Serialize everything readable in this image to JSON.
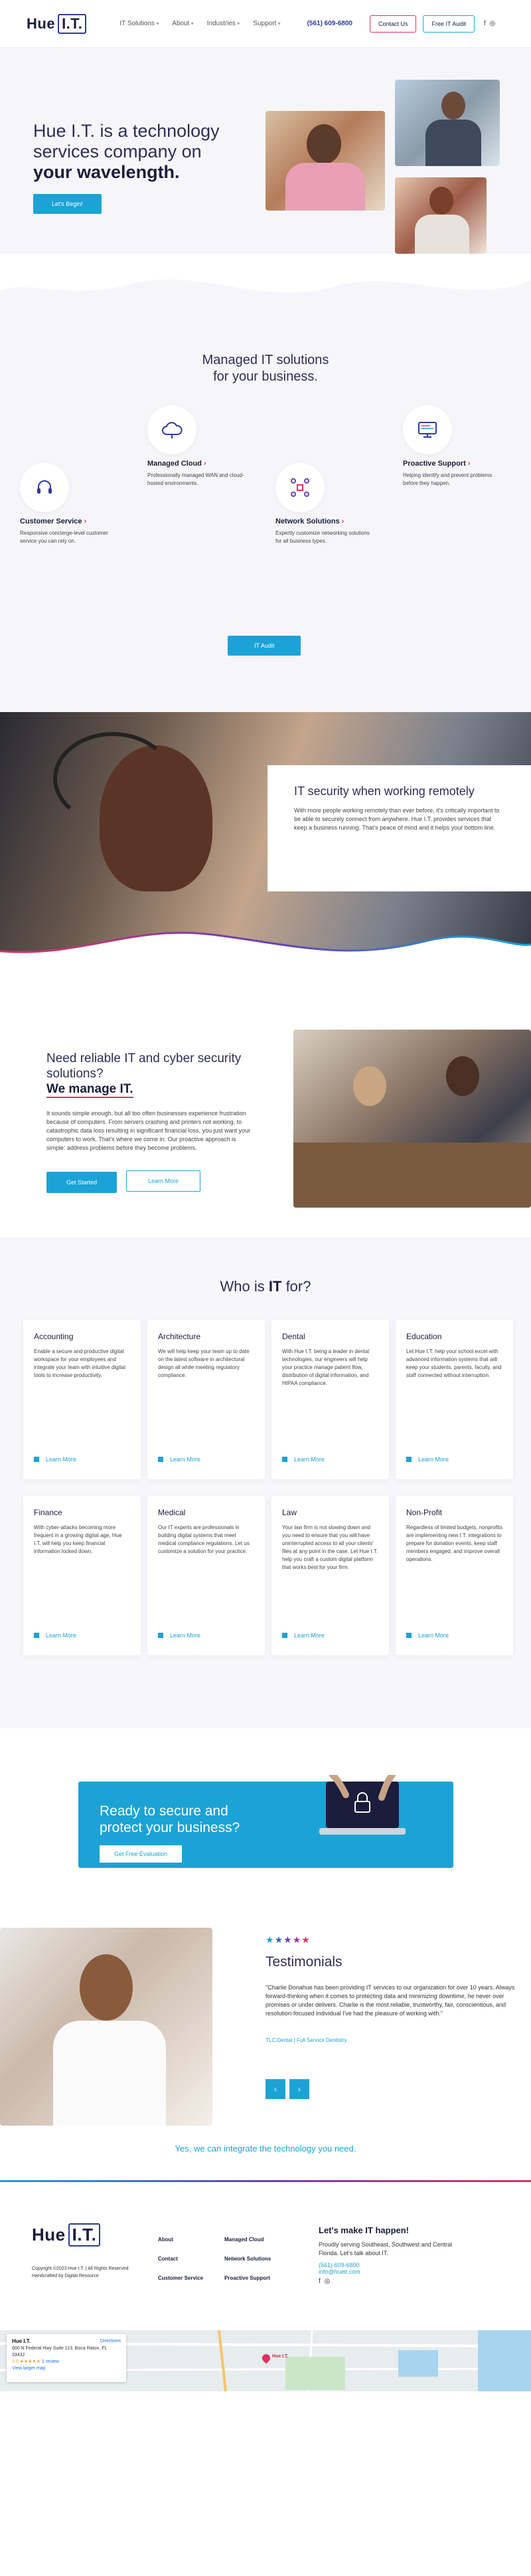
{
  "header": {
    "logo_text": "Hue",
    "logo_box": "I.T.",
    "nav": [
      "IT Solutions",
      "About",
      "Industries",
      "Support"
    ],
    "phone": "(561) 609-6800",
    "contact_label": "Contact Us",
    "audit_label": "Free IT Audit",
    "social": [
      "f",
      "◎"
    ]
  },
  "hero": {
    "title_line": "Hue I.T. is a technology services company on",
    "title_bold": "your wavelength.",
    "cta": "Let's Begin!"
  },
  "managed": {
    "title_line1": "Managed IT solutions",
    "title_line2": "for your business.",
    "services": [
      {
        "name": "Customer Service",
        "desc": "Responsive concierge-level customer service you can rely on.",
        "icon": "headset-icon"
      },
      {
        "name": "Managed Cloud",
        "desc": "Professionally managed WAN and cloud-hosted environments.",
        "icon": "cloud-icon"
      },
      {
        "name": "Network Solutions",
        "desc": "Expertly customize networking solutions for all business types.",
        "icon": "network-icon"
      },
      {
        "name": "Proactive Support",
        "desc": "Helping identify and prevent problems before they happen.",
        "icon": "monitor-icon"
      }
    ],
    "cta": "IT Audit"
  },
  "security": {
    "title": "IT security when working remotely",
    "body": "With more people working remotely than ever before, it's critically important to be able to securely connect from anywhere. Hue I.T. provides services that keep a business running. That's peace of mind and it helps your bottom line."
  },
  "reliable": {
    "title": "Need reliable IT and cyber security solutions?",
    "title_bold": "We manage IT.",
    "body": "It sounds simple enough, but all too often businesses experience frustration because of computers. From servers crashing and printers not working, to catastrophic data loss resulting in significant financial loss, you just want your computers to work. That's where we come in. Our proactive approach is simple: address problems before they become problems.",
    "btn_primary": "Get Started",
    "btn_secondary": "Learn More"
  },
  "who": {
    "title_prefix": "Who is",
    "title_bold": "IT",
    "title_suffix": "for?",
    "learn_more": "Learn More",
    "cards": [
      {
        "name": "Accounting",
        "desc": "Enable a secure and productive digital workspace for your employees and integrate your team with intuitive digital tools to increase productivity."
      },
      {
        "name": "Architecture",
        "desc": "We will help keep your team up to date on the latest software in architectural design all while meeting regulatory compliance."
      },
      {
        "name": "Dental",
        "desc": "With Hue I.T. being a leader in dental technologies, our engineers will help your practice manage patient flow, distribution of digital information, and HIPAA compliance."
      },
      {
        "name": "Education",
        "desc": "Let Hue I.T. help your school excel with advanced information systems that will keep your students, parents, faculty, and staff connected without interruption."
      },
      {
        "name": "Finance",
        "desc": "With cyber-attacks becoming more frequent in a growing digital age, Hue I.T. will help you keep financial information locked down."
      },
      {
        "name": "Medical",
        "desc": "Our IT experts are professionals in building digital systems that meet medical compliance regulations. Let us customize a solution for your practice."
      },
      {
        "name": "Law",
        "desc": "Your law firm is not slowing down and you need to ensure that you will have uninterrupted access to all your clients' files at any point in the case. Let Hue I.T. help you craft a custom digital platform that works best for your firm."
      },
      {
        "name": "Non-Profit",
        "desc": "Regardless of limited budgets, nonprofits are implementing new I.T. integrations to prepare for donation events, keep staff members engaged, and improve overall operations."
      }
    ]
  },
  "cta": {
    "title": "Ready to secure and protect your business?",
    "button": "Get Free Evaluation"
  },
  "testimonials": {
    "stars": [
      "★",
      "★",
      "★",
      "★",
      "★"
    ],
    "title": "Testimonials",
    "quote": "\"Charlie Donahue has been providing IT services to our organization for over 10 years. Always forward-thinking when it comes to protecting data and minimizing downtime, he never over promises or under delivers. Charlie is the most reliable, trustworthy, fair, conscientious, and resolution-focused individual I've had the pleasure of working with.\"",
    "cite": "TLC Dental | Full Service Dentistry",
    "prev": "‹",
    "next": "›",
    "tagline": "Yes, we can integrate the technology you need."
  },
  "footer": {
    "logo_text": "Hue",
    "logo_box": "I.T.",
    "copyright": "Copyright ©2023 Hue I.T. | All Rights Reserved",
    "credit": "Handcrafted by Digital Resource",
    "col1": [
      "About",
      "Contact",
      "Customer Service"
    ],
    "col2": [
      "Managed Cloud",
      "Network Solutions",
      "Proactive Support"
    ],
    "make_title": "Let's make IT happen!",
    "make_body": "Proudly serving Southeast, Southwest and Central Florida. Let's talk about IT.",
    "phone": "(561) 609-6800",
    "email": "info@hueit.com",
    "social": [
      "f",
      "◎"
    ]
  },
  "map": {
    "name": "Hue I.T.",
    "address": "600 N Federal Hwy Suite 113, Boca Raton, FL 33432",
    "rating": "5.0 ★★★★★",
    "reviews": "1 review",
    "larger": "View larger map",
    "directions": "Directions",
    "pin_label": "Hue I.T."
  },
  "colors": {
    "accent": "#1ba3d6",
    "brand": "#2f3a9a",
    "pink": "#e0305f",
    "navy": "#1a1d3b"
  }
}
